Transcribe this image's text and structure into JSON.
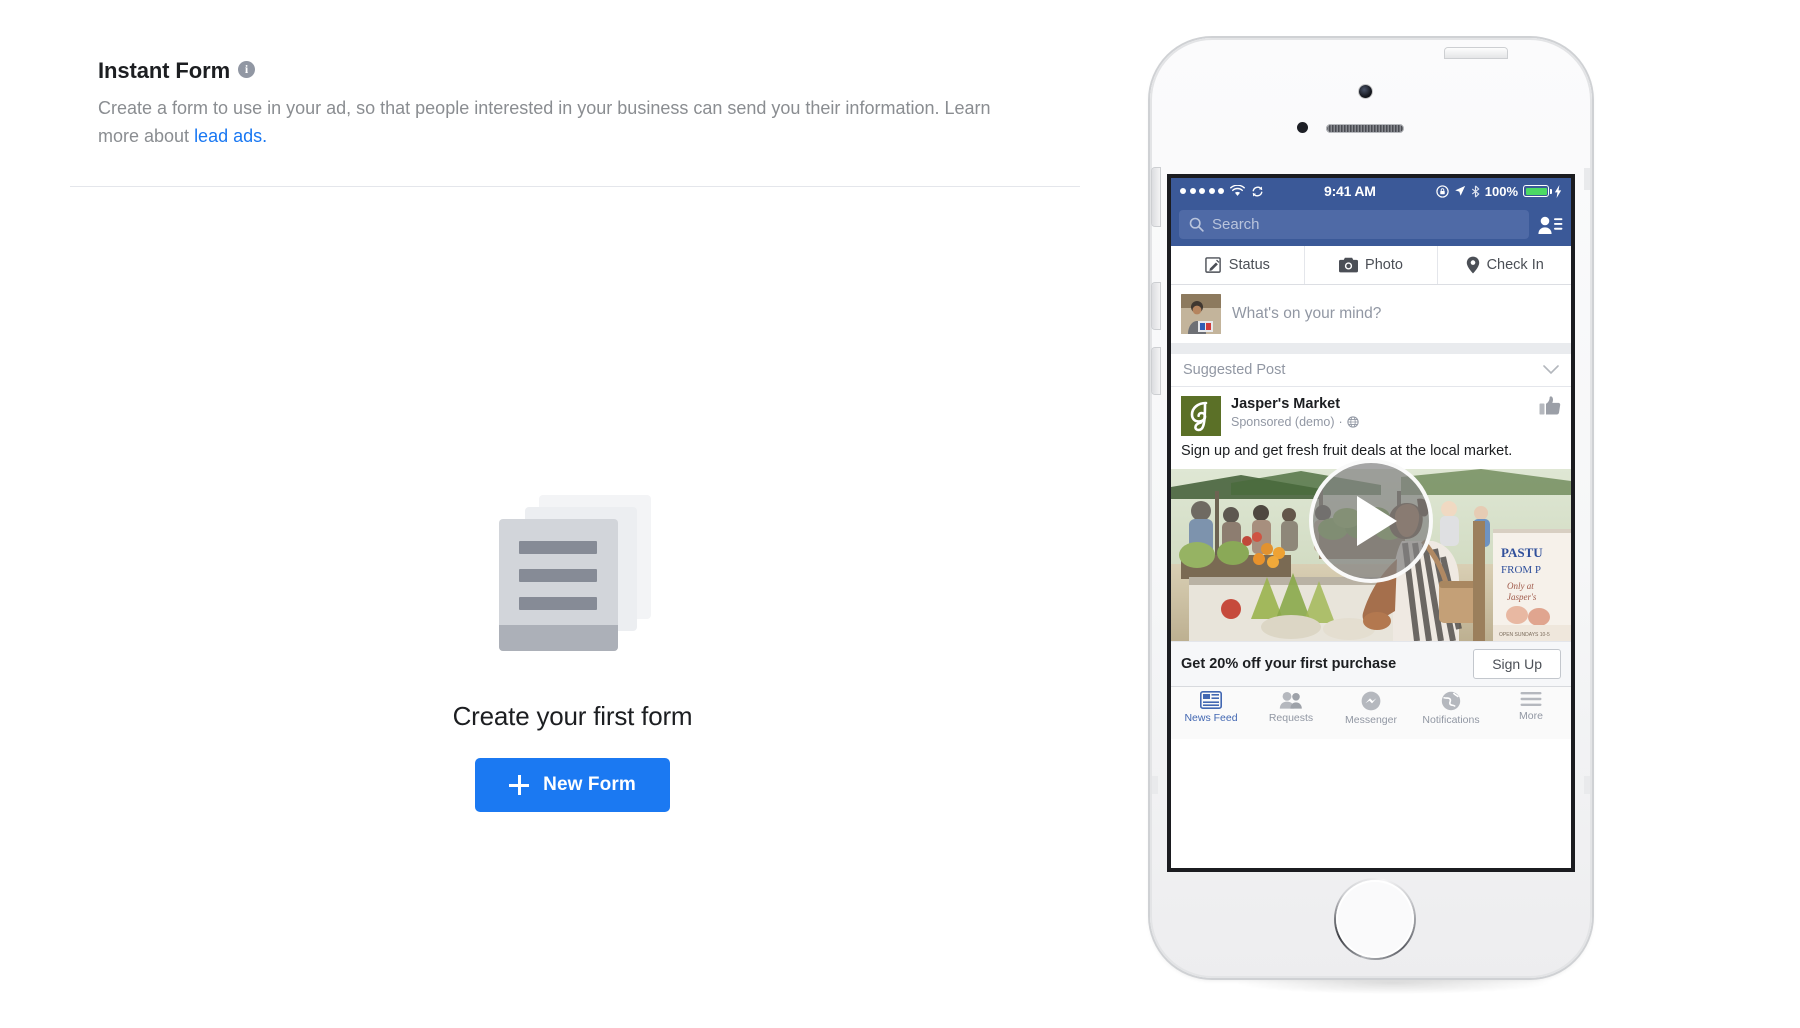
{
  "section": {
    "title": "Instant Form",
    "info_icon": "info-icon",
    "description_part1": "Create a form to use in your ad, so that people interested in your business can send you their information. Learn more about ",
    "link_text": "lead ads.",
    "link_color": "#1877f2"
  },
  "empty_state": {
    "icon": "form-stack-icon",
    "title": "Create your first form",
    "button_label": "New Form",
    "button_icon": "plus-icon",
    "button_color": "#1b79f2"
  },
  "phone": {
    "status_bar": {
      "carrier_dots": 5,
      "wifi_icon": "wifi-icon",
      "sync_icon": "sync-icon",
      "time": "9:41 AM",
      "rotation_lock_icon": "rotation-lock-icon",
      "location_icon": "location-arrow-icon",
      "bluetooth_icon": "bluetooth-icon",
      "battery_percent": "100%",
      "battery_color": "#4cd964",
      "charging_icon": "lightning-bolt-icon",
      "bar_color": "#3b5998"
    },
    "navbar": {
      "search_placeholder": "Search",
      "search_icon": "search-icon",
      "friends_icon": "friend-requests-icon"
    },
    "composer_actions": [
      {
        "label": "Status",
        "icon": "pencil-square-icon"
      },
      {
        "label": "Photo",
        "icon": "camera-icon"
      },
      {
        "label": "Check In",
        "icon": "location-pin-icon"
      }
    ],
    "composer": {
      "placeholder": "What's on your mind?",
      "avatar": "user-avatar"
    },
    "suggested": {
      "label": "Suggested Post",
      "chevron_icon": "chevron-down-icon"
    },
    "post": {
      "page_name": "Jasper's Market",
      "page_logo": "jaspers-market-logo",
      "meta": "Sponsored (demo)",
      "meta_separator": "·",
      "globe_icon": "globe-icon",
      "like_icon": "thumbs-up-icon",
      "body_text": "Sign up and get fresh fruit deals at the local market.",
      "photo_alt": "farmers-market-photo",
      "play_icon": "play-button-overlay",
      "cta_title": "Get 20% off your first purchase",
      "cta_button": "Sign Up"
    },
    "tabbar": [
      {
        "label": "News Feed",
        "icon": "news-feed-icon",
        "active": true
      },
      {
        "label": "Requests",
        "icon": "friends-requests-icon",
        "active": false
      },
      {
        "label": "Messenger",
        "icon": "messenger-icon",
        "active": false
      },
      {
        "label": "Notifications",
        "icon": "globe-notifications-icon",
        "active": false
      },
      {
        "label": "More",
        "icon": "hamburger-menu-icon",
        "active": false
      }
    ]
  }
}
